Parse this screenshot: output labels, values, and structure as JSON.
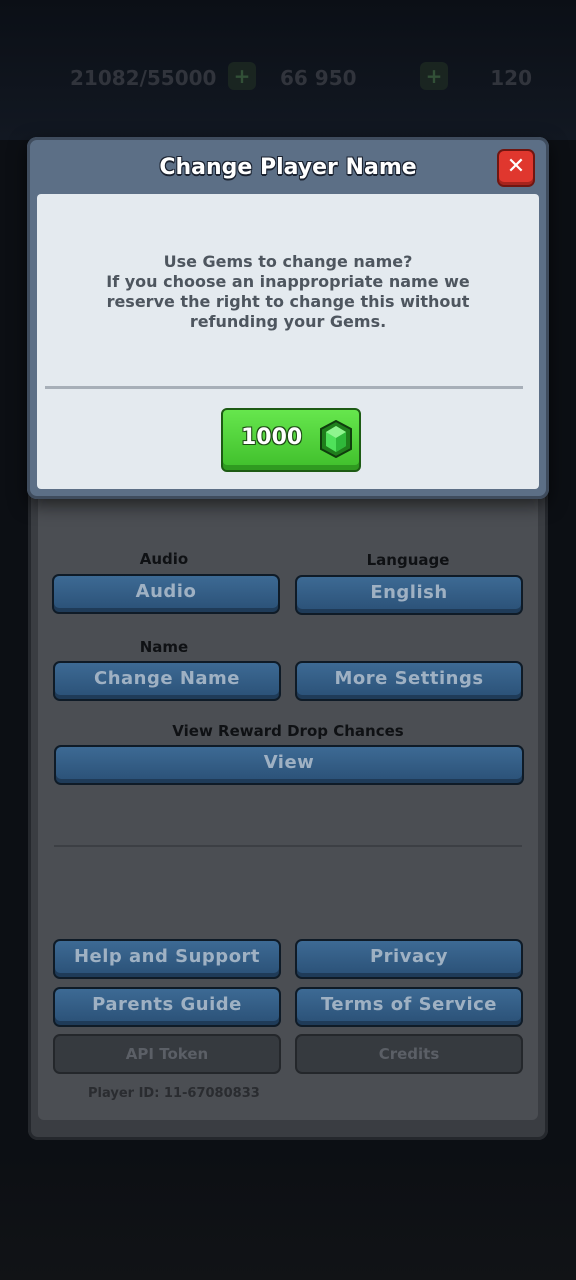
{
  "hud": {
    "trophy_text": "21082/55000",
    "gold_text": "66 950",
    "right_text": "120"
  },
  "modal": {
    "title": "Change Player Name",
    "close_icon": "close-icon",
    "message_lines": [
      "Use Gems to change name?",
      "If you choose an inappropriate name we",
      "reserve the right to change this without",
      "refunding your Gems."
    ],
    "price": "1000",
    "gem_icon": "gem-icon"
  },
  "settings": {
    "audio_label": "Audio",
    "audio_button": "Audio",
    "language_label": "Language",
    "language_button": "English",
    "name_label": "Name",
    "change_name_button": "Change Name",
    "more_settings_button": "More Settings",
    "reward_label": "View Reward Drop Chances",
    "view_button": "View",
    "help_button": "Help and Support",
    "privacy_button": "Privacy",
    "parents_button": "Parents Guide",
    "terms_button": "Terms of Service",
    "api_button": "API Token",
    "credits_button": "Credits",
    "player_id": "Player ID: 11-67080833"
  },
  "colors": {
    "modal_frame": "#5c6f86",
    "modal_body": "#e4eaef",
    "gem_button": "#4fd13a",
    "blue_button": "#2f5a84",
    "close_button": "#e0372e"
  }
}
